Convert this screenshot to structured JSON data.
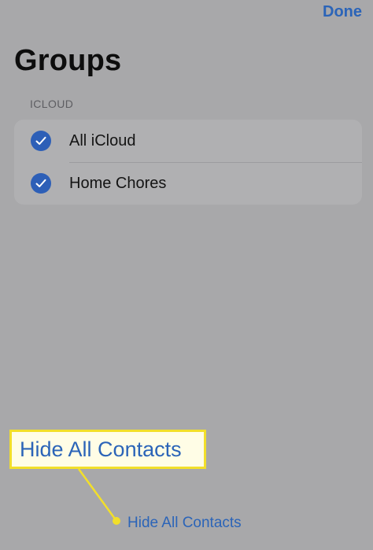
{
  "nav": {
    "done_label": "Done"
  },
  "page": {
    "title": "Groups"
  },
  "section": {
    "header": "ICLOUD",
    "groups": [
      {
        "label": "All iCloud",
        "checked": true
      },
      {
        "label": "Home Chores",
        "checked": true
      }
    ]
  },
  "footer": {
    "hide_all_label": "Hide All Contacts"
  },
  "callout": {
    "label": "Hide All Contacts"
  },
  "colors": {
    "accent": "#2b64b8",
    "highlight_border": "#f2df2a",
    "background": "#a8a8aa"
  }
}
